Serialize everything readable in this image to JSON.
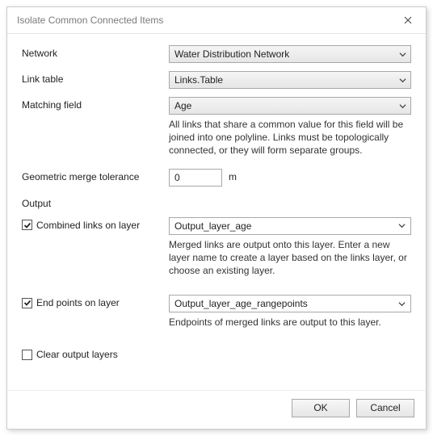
{
  "window": {
    "title": "Isolate Common Connected Items"
  },
  "labels": {
    "network": "Network",
    "link_table": "Link table",
    "matching_field": "Matching field",
    "geom_tol": "Geometric merge tolerance",
    "output": "Output",
    "combined": "Combined links on layer",
    "endpoints": "End points on layer",
    "clear": "Clear output layers"
  },
  "fields": {
    "network": "Water Distribution Network",
    "link_table": "Links.Table",
    "matching_field": "Age",
    "geom_tol_value": "0",
    "geom_tol_unit": "m",
    "combined_layer": "Output_layer_age",
    "endpoints_layer": "Output_layer_age_rangepoints"
  },
  "descriptions": {
    "matching_field": "All links that share a common value for this field will be joined into one polyline. Links must be topologically connected, or they will form separate groups.",
    "combined": "Merged links are output onto this layer. Enter a new layer name to create a layer based on the links layer, or choose an existing layer.",
    "endpoints": "Endpoints of merged links are output to this layer."
  },
  "buttons": {
    "ok": "OK",
    "cancel": "Cancel"
  }
}
